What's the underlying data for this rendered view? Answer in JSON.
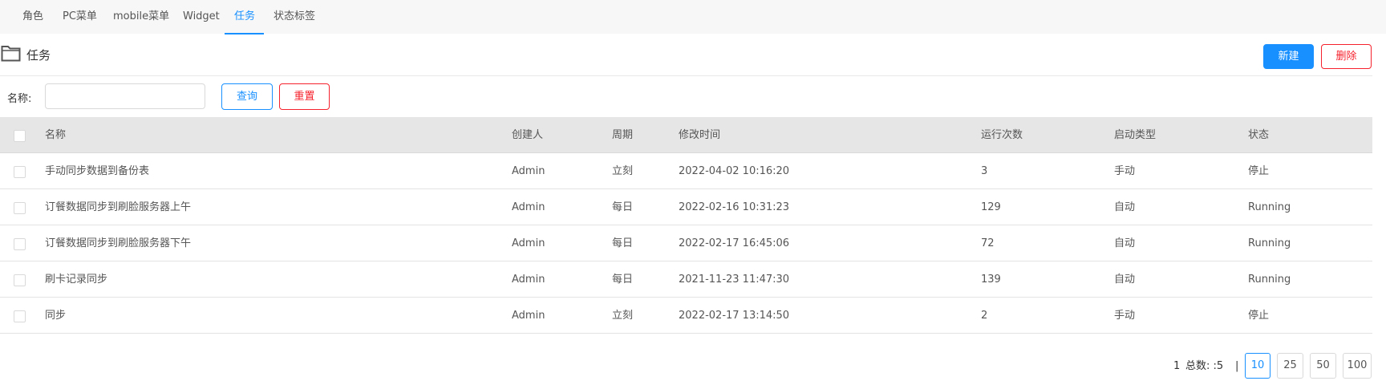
{
  "tabs": [
    {
      "label": "角色"
    },
    {
      "label": "PC菜单"
    },
    {
      "label": "mobile菜单"
    },
    {
      "label": "Widget"
    },
    {
      "label": "任务"
    },
    {
      "label": "状态标签"
    }
  ],
  "active_tab": "任务",
  "header": {
    "title": "任务",
    "new_label": "新建",
    "delete_label": "删除"
  },
  "search": {
    "label": "名称:",
    "value": "",
    "query_label": "查询",
    "reset_label": "重置"
  },
  "table": {
    "columns": [
      "名称",
      "创建人",
      "周期",
      "修改时间",
      "运行次数",
      "启动类型",
      "状态"
    ],
    "rows": [
      {
        "name": "手动同步数据到备份表",
        "creator": "Admin",
        "cycle": "立刻",
        "modified": "2022-04-02 10:16:20",
        "runs": "3",
        "start_type": "手动",
        "status": "停止"
      },
      {
        "name": "订餐数据同步到刷脸服务器上午",
        "creator": "Admin",
        "cycle": "每日",
        "modified": "2022-02-16 10:31:23",
        "runs": "129",
        "start_type": "自动",
        "status": "Running"
      },
      {
        "name": "订餐数据同步到刷脸服务器下午",
        "creator": "Admin",
        "cycle": "每日",
        "modified": "2022-02-17 16:45:06",
        "runs": "72",
        "start_type": "自动",
        "status": "Running"
      },
      {
        "name": "刷卡记录同步",
        "creator": "Admin",
        "cycle": "每日",
        "modified": "2021-11-23 11:47:30",
        "runs": "139",
        "start_type": "自动",
        "status": "Running"
      },
      {
        "name": "同步",
        "creator": "Admin",
        "cycle": "立刻",
        "modified": "2022-02-17 13:14:50",
        "runs": "2",
        "start_type": "手动",
        "status": "停止"
      }
    ]
  },
  "pagination": {
    "current_page": "1",
    "total_text": "总数: :5",
    "separator": "|",
    "page_sizes": [
      "10",
      "25",
      "50",
      "100"
    ],
    "selected_size": "10"
  },
  "colors": {
    "accent": "#1890ff",
    "danger": "#f5222d",
    "header_bg": "#e6e6e6"
  }
}
